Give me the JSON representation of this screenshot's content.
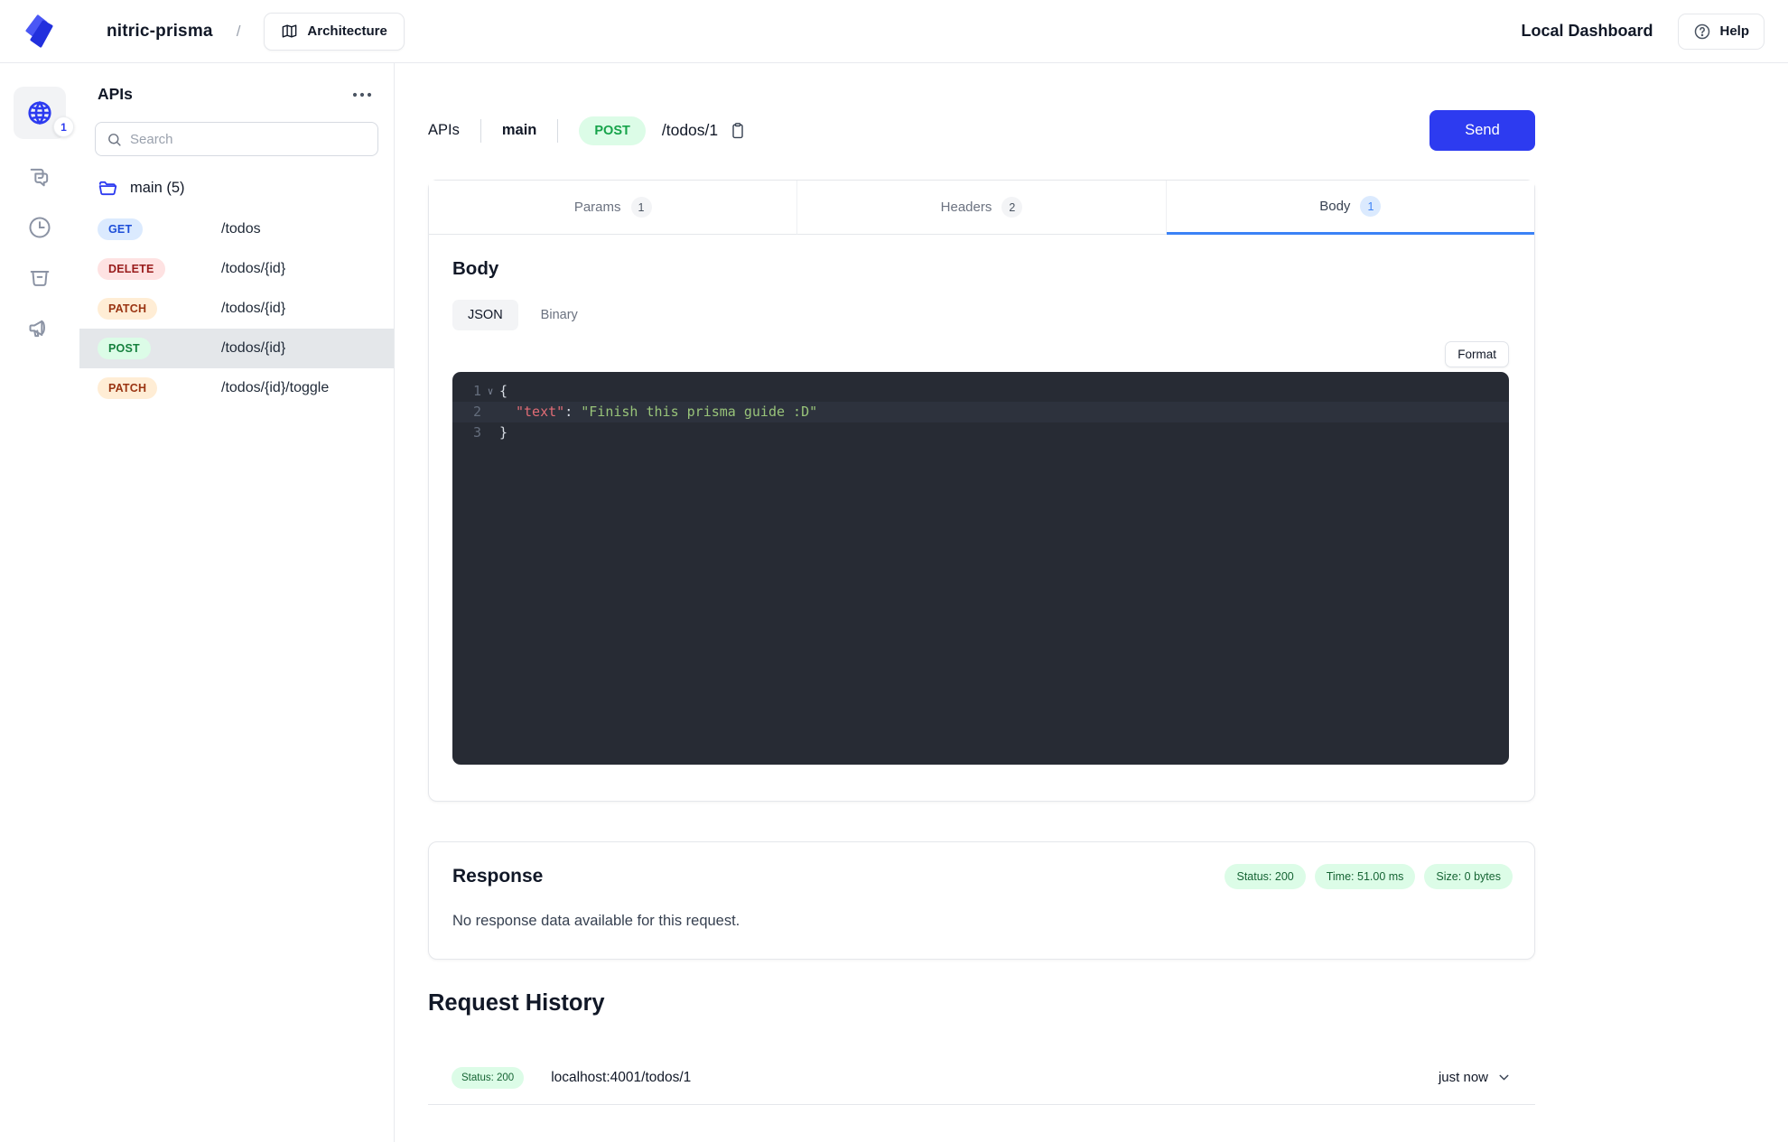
{
  "topbar": {
    "project_name": "nitric-prisma",
    "breadcrumb_separator": "/",
    "architecture_button": "Architecture",
    "dashboard_title": "Local Dashboard",
    "help_button": "Help"
  },
  "rail": {
    "apis_badge_count": "1"
  },
  "sidebar": {
    "title": "APIs",
    "search_placeholder": "Search",
    "folder_label": "main (5)",
    "endpoints": [
      {
        "method": "GET",
        "path": "/todos"
      },
      {
        "method": "DELETE",
        "path": "/todos/{id}"
      },
      {
        "method": "PATCH",
        "path": "/todos/{id}"
      },
      {
        "method": "POST",
        "path": "/todos/{id}"
      },
      {
        "method": "PATCH",
        "path": "/todos/{id}/toggle"
      }
    ]
  },
  "request": {
    "breadcrumb_root": "APIs",
    "breadcrumb_api": "main",
    "method": "POST",
    "path": "/todos/1",
    "send_button": "Send",
    "tabs": [
      {
        "label": "Params",
        "badge": "1"
      },
      {
        "label": "Headers",
        "badge": "2"
      },
      {
        "label": "Body",
        "badge": "1"
      }
    ]
  },
  "body_panel": {
    "heading": "Body",
    "mode_json": "JSON",
    "mode_binary": "Binary",
    "format_button": "Format",
    "editor_lines": [
      {
        "number": "1",
        "open_brace": "{"
      },
      {
        "number": "2",
        "key": "\"text\"",
        "colon": ": ",
        "value": "\"Finish this prisma guide :D\""
      },
      {
        "number": "3",
        "close_brace": "}"
      }
    ]
  },
  "response": {
    "heading": "Response",
    "status_badge": "Status: 200",
    "time_badge": "Time: 51.00 ms",
    "size_badge": "Size: 0 bytes",
    "empty_message": "No response data available for this request."
  },
  "history": {
    "heading": "Request History",
    "rows": [
      {
        "status": "Status: 200",
        "url": "localhost:4001/todos/1",
        "time": "just now"
      }
    ]
  },
  "colors": {
    "accent_blue": "#2d3bf0",
    "tab_active_blue": "#3b82f6",
    "success_green_bg": "#dcfce7",
    "success_green_text": "#166534",
    "editor_bg": "#272b34",
    "editor_key_red": "#e06c75",
    "editor_string_green": "#98c379"
  }
}
